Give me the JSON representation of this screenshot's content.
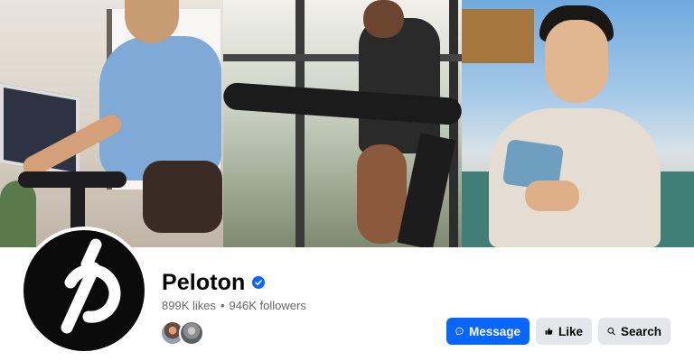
{
  "page": {
    "name": "Peloton",
    "verified": true,
    "likes": "899K likes",
    "separator": "•",
    "followers": "946K followers"
  },
  "actions": {
    "message_label": "Message",
    "like_label": "Like",
    "search_label": "Search"
  },
  "icons": {
    "verified": "verified-badge-icon",
    "message": "messenger-icon",
    "like": "thumbs-up-icon",
    "search": "search-icon",
    "logo": "peloton-logo-icon"
  },
  "colors": {
    "primary": "#0866ff",
    "secondary_button": "#e4e6eb",
    "muted_text": "#65676b",
    "avatar_bg": "#0b0b0b"
  }
}
